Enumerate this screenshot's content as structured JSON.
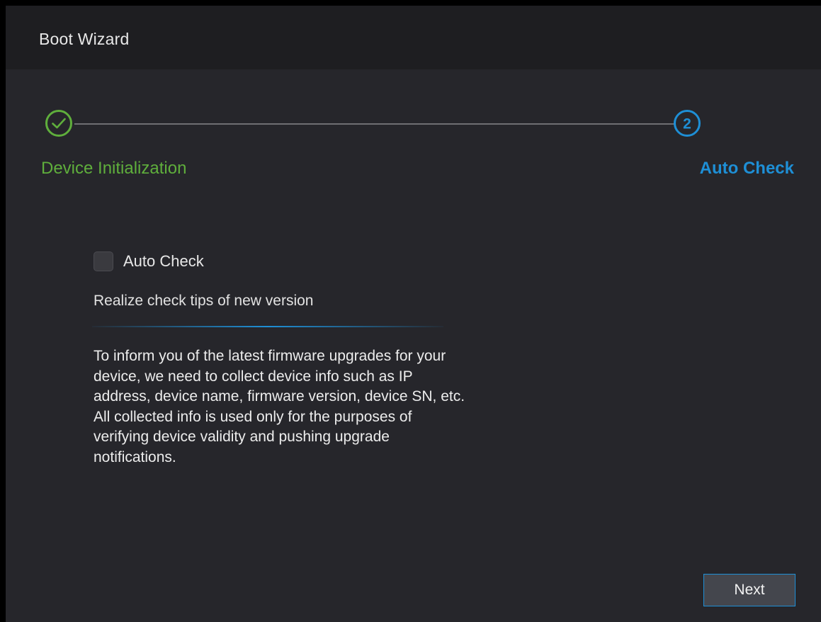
{
  "window": {
    "title": "Boot Wizard"
  },
  "steps": [
    {
      "label": "Device Initialization",
      "number": "",
      "status": "completed",
      "color": "#5fae3c"
    },
    {
      "label": "Auto Check",
      "number": "2",
      "status": "current",
      "color": "#1e8fd6"
    }
  ],
  "form": {
    "auto_check_label": "Auto Check",
    "auto_check_checked": false,
    "tips": "Realize check tips of new version",
    "description_lines": [
      "To inform you of the latest firmware upgrades for your",
      "device, we need to collect device info such as IP",
      "address, device name, firmware version, device SN, etc.",
      "All collected info is used only for the purposes of",
      "verifying device validity and pushing upgrade",
      "notifications."
    ]
  },
  "footer": {
    "next_label": "Next"
  },
  "colors": {
    "background": "#26262b",
    "titlebar": "#1e1e21",
    "accent": "#1e8fd6",
    "success": "#5fae3c"
  }
}
